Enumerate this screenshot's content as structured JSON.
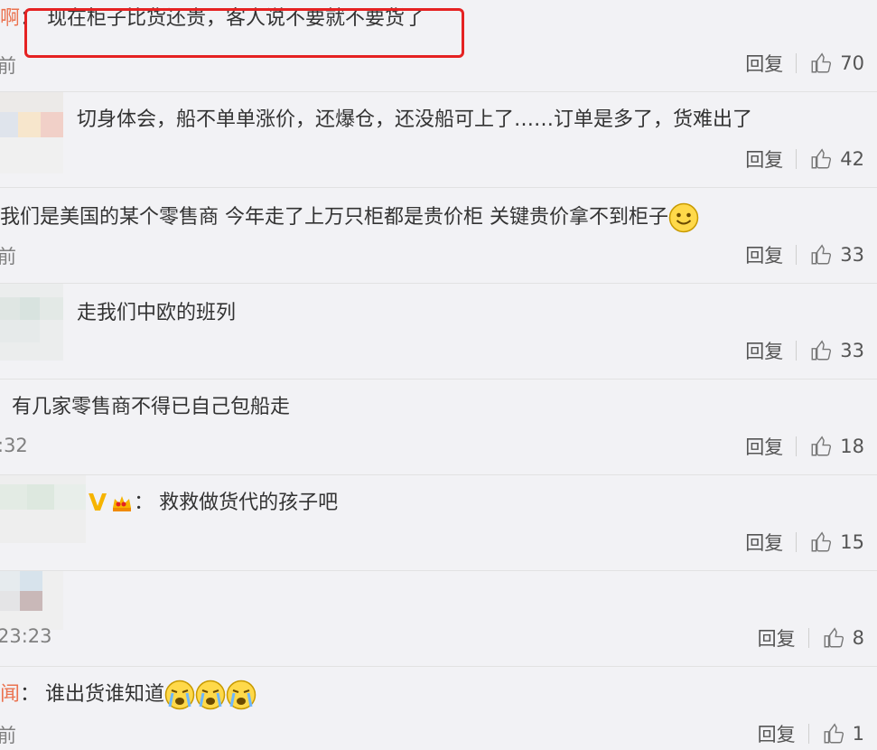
{
  "comments": [
    {
      "username_fragment": "啊",
      "colon": "：",
      "text": "现在柜子比货还贵，客人说不要就不要货了",
      "time": "前",
      "reply": "回复",
      "likes": "70"
    },
    {
      "text": "切身体会，船不单单涨价，还爆仓，还没船可上了……订单是多了，货难出了",
      "time": "",
      "reply": "回复",
      "likes": "42"
    },
    {
      "text": "我们是美国的某个零售商 今年走了上万只柜都是贵价柜 关键贵价拿不到柜子",
      "time": "前",
      "reply": "回复",
      "likes": "33"
    },
    {
      "text": "走我们中欧的班列",
      "time": "",
      "reply": "回复",
      "likes": "33"
    },
    {
      "text": "有几家零售商不得已自己包船走",
      "time": ":32",
      "reply": "回复",
      "likes": "18"
    },
    {
      "vip": "V",
      "colon": "：",
      "text": "救救做货代的孩子吧",
      "time": "",
      "reply": "回复",
      "likes": "15"
    },
    {
      "text": "",
      "time": "23:23",
      "reply": "回复",
      "likes": "8"
    },
    {
      "username_fragment": "闻",
      "colon": "：",
      "text": "谁出货谁知道",
      "time": "前",
      "reply": "回复",
      "likes": "1"
    }
  ],
  "colors": {
    "highlight": "#e52222",
    "username": "#eb7350",
    "vip": "#f6b400"
  }
}
